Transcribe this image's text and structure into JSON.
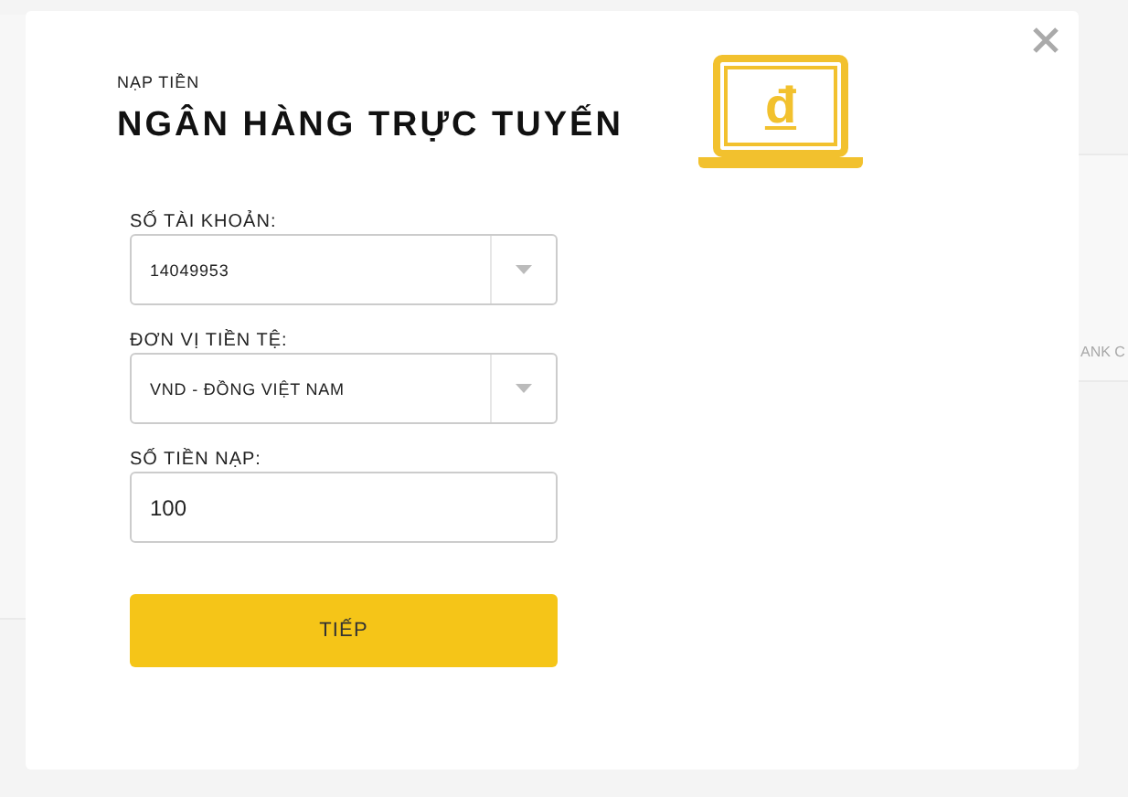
{
  "background": {
    "right_fragment": "ANK C"
  },
  "modal": {
    "eyebrow": "NẠP TIỀN",
    "title": "NGÂN HÀNG TRỰC TUYẾN",
    "icon_glyph": "đ",
    "fields": [
      {
        "kind": "select",
        "label": "SỐ TÀI KHOẢN:",
        "value": "14049953"
      },
      {
        "kind": "select",
        "label": "ĐƠN VỊ TIỀN TỆ:",
        "value": "VND - ĐỒNG VIỆT NAM"
      },
      {
        "kind": "input",
        "label": "SỐ TIỀN NẠP:",
        "value": "100"
      }
    ],
    "submit": "TIẾP"
  }
}
